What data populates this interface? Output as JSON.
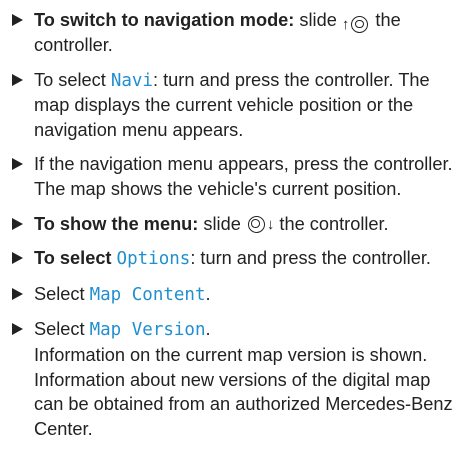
{
  "steps": [
    {
      "lead": "To switch to navigation mode:",
      "pre": " slide ",
      "post": " the controller."
    },
    {
      "pre": "To select ",
      "term": "Navi",
      "post": ": turn and press the controller. The map displays the current vehicle position or the navigation menu appears."
    },
    {
      "text": "If the navigation menu appears, press the controller.",
      "result": "The map shows the vehicle's current position."
    },
    {
      "lead": "To show the menu:",
      "pre": " slide ",
      "post": " the controller."
    },
    {
      "lead_pre": "To select ",
      "lead_term": "Options",
      "post": ": turn and press the con­troller."
    },
    {
      "pre": "Select ",
      "term": "Map Content",
      "post": "."
    },
    {
      "pre": "Select ",
      "term": "Map Version",
      "post": ".",
      "result": "Information on the current map version is shown. Information about new versions of the digital map can be obtained from an author­ized Mercedes-Benz Center."
    }
  ],
  "icons": {
    "slide_up": "controller-slide-up-icon",
    "slide_down": "controller-slide-down-icon"
  },
  "colors": {
    "highlight": "#1f8fd0",
    "text": "#222222"
  }
}
